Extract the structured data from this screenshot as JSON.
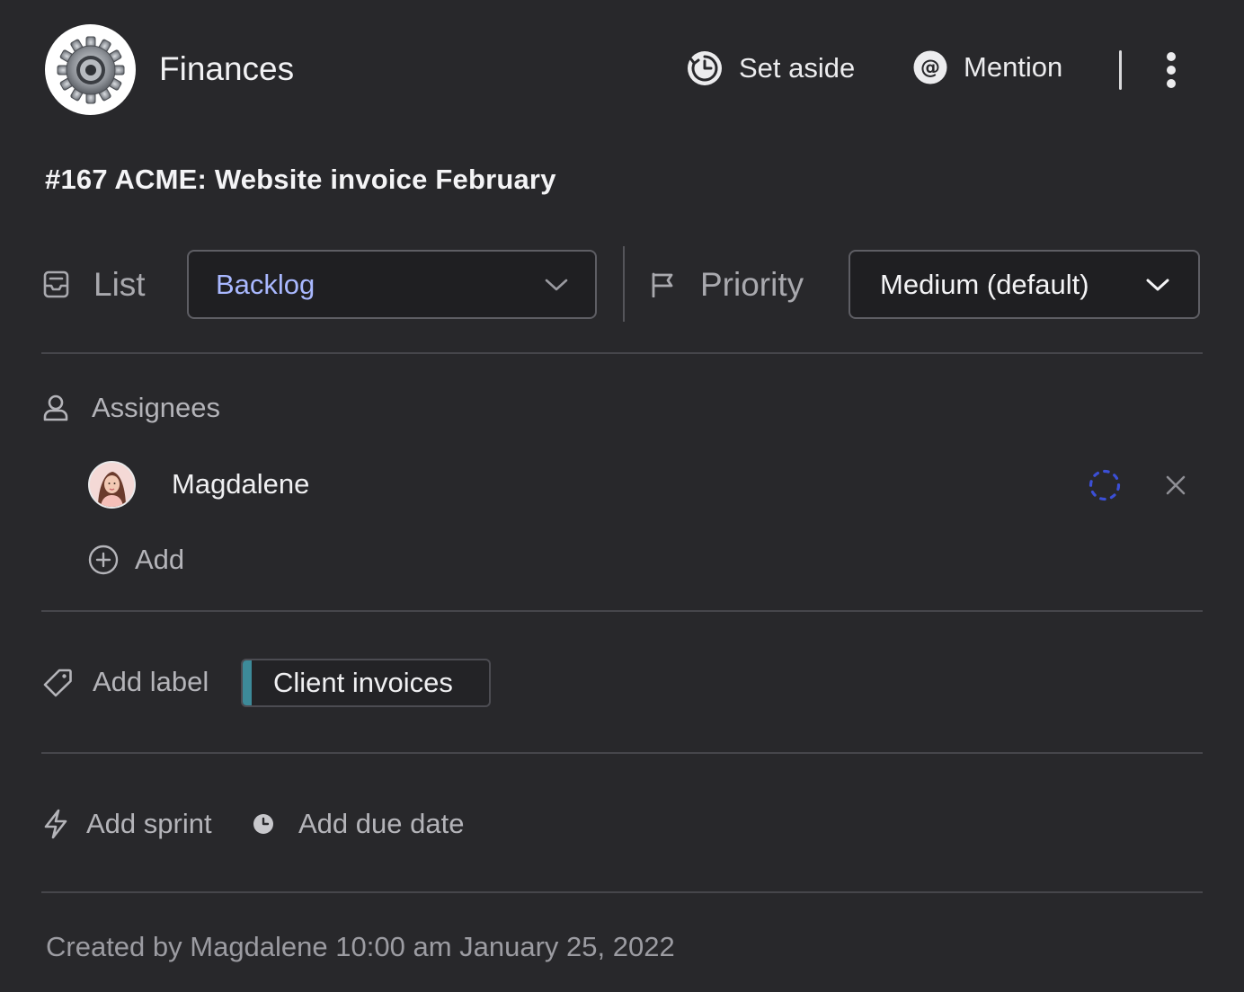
{
  "header": {
    "app_title": "Finances",
    "set_aside_label": "Set aside",
    "mention_label": "Mention"
  },
  "task": {
    "title": "#167 ACME: Website invoice February"
  },
  "fields": {
    "list_label": "List",
    "list_value": "Backlog",
    "priority_label": "Priority",
    "priority_value": "Medium (default)"
  },
  "assignees": {
    "label": "Assignees",
    "items": [
      {
        "name": "Magdalene"
      }
    ],
    "add_label": "Add"
  },
  "labels": {
    "add_label": "Add label",
    "items": [
      {
        "name": "Client invoices",
        "color": "#3d8a99"
      }
    ]
  },
  "planning": {
    "sprint_label": "Add sprint",
    "due_date_label": "Add due date"
  },
  "footer": {
    "created_text": "Created by Magdalene 10:00 am January 25, 2022"
  },
  "colors": {
    "background": "#28282b",
    "list_value_color": "#a9b8ff",
    "loader_color": "#3b4fd6"
  },
  "icons": [
    "gear-icon",
    "clock-icon",
    "at-icon",
    "more-vertical-icon",
    "inbox-icon",
    "chevron-down-icon",
    "flag-icon",
    "user-icon",
    "loader-icon",
    "close-icon",
    "plus-circle-icon",
    "tag-icon",
    "bolt-icon"
  ]
}
